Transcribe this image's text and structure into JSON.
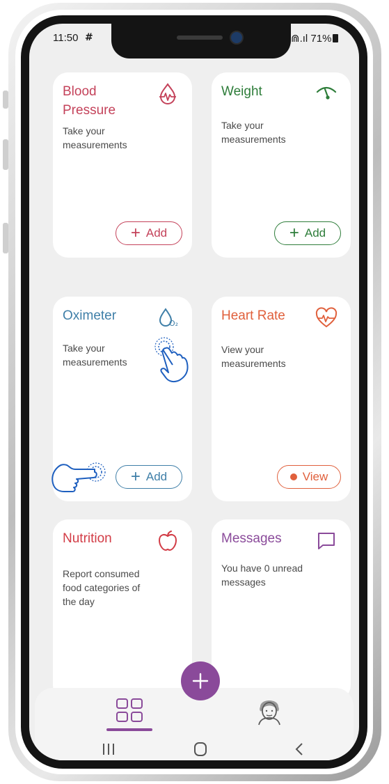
{
  "status_bar": {
    "time": "11:50",
    "grid_glyph": "#",
    "signal_text": "⋒.ıl",
    "battery": "71%"
  },
  "cards": {
    "blood_pressure": {
      "title_line1": "Blood",
      "title_line2": "Pressure",
      "desc_line1": "Take your",
      "desc_line2": "measurements",
      "button": "Add",
      "icon": "blood-drop-pulse-icon",
      "color": "#c4425a"
    },
    "weight": {
      "title": "Weight",
      "desc_line1": "Take your",
      "desc_line2": "measurements",
      "button": "Add",
      "icon": "scale-gauge-icon",
      "color": "#2e7d3a"
    },
    "oximeter": {
      "title": "Oximeter",
      "desc_line1": "Take your",
      "desc_line2": "measurements",
      "button": "Add",
      "icon": "oxygen-drop-icon",
      "color": "#3f7fa8"
    },
    "heart_rate": {
      "title": "Heart Rate",
      "desc_line1": "View your",
      "desc_line2": "measurements",
      "button": "View",
      "icon": "heart-pulse-icon",
      "color": "#e0603c"
    },
    "nutrition": {
      "title": "Nutrition",
      "desc_line1": "Report consumed",
      "desc_line2": "food categories of",
      "desc_line3": "the day",
      "icon": "apple-icon",
      "color": "#d23c46"
    },
    "messages": {
      "title": "Messages",
      "desc_line1": "You have 0 unread",
      "desc_line2": "messages",
      "icon": "message-bubble-icon",
      "color": "#8a4a9a"
    }
  },
  "bottom_nav": {
    "items": [
      "dashboard-grid-icon",
      "profile-avatar-icon"
    ],
    "fab_icon": "plus-icon",
    "accent": "#8a4a9a"
  },
  "hint_icons": [
    "tap-hand-icon",
    "point-hand-icon"
  ],
  "hint_color": "#1e5fbf",
  "system_nav": [
    "recent-apps-icon",
    "home-icon",
    "back-icon"
  ]
}
